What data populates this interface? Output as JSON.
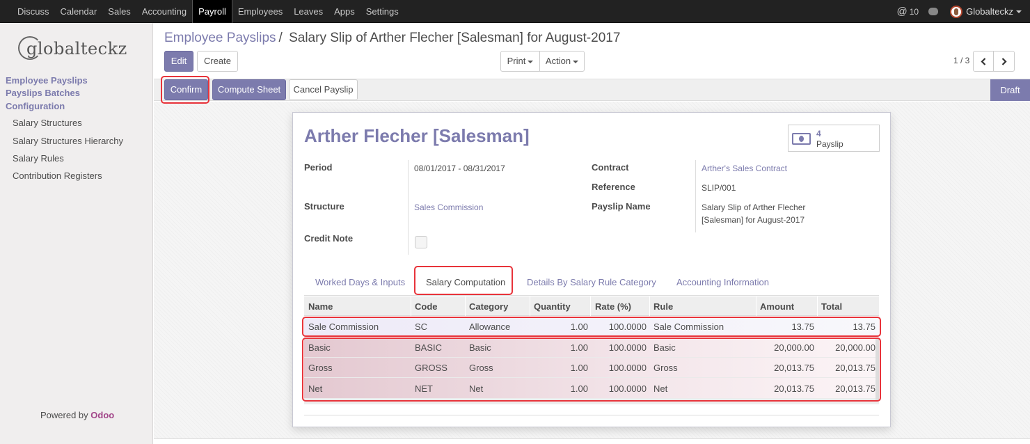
{
  "topbar": {
    "menu": [
      "Discuss",
      "Calendar",
      "Sales",
      "Accounting",
      "Payroll",
      "Employees",
      "Leaves",
      "Apps",
      "Settings"
    ],
    "active": "Payroll",
    "notification_count": "10",
    "user": "Globalteckz"
  },
  "sidebar": {
    "logo_text": "globalteckz",
    "sections": [
      "Employee Payslips",
      "Payslips Batches",
      "Configuration"
    ],
    "items": [
      "Salary Structures",
      "Salary Structures Hierarchy",
      "Salary Rules",
      "Contribution Registers"
    ],
    "powered_prefix": "Powered by",
    "powered_brand": "Odoo"
  },
  "breadcrumb": {
    "parent": "Employee Payslips",
    "separator": "/",
    "current": "Salary Slip of Arther Flecher [Salesman] for August-2017"
  },
  "buttons": {
    "edit": "Edit",
    "create": "Create",
    "print": "Print",
    "action": "Action",
    "confirm": "Confirm",
    "compute_sheet": "Compute Sheet",
    "cancel_payslip": "Cancel Payslip"
  },
  "pager": {
    "text": "1 / 3"
  },
  "status": {
    "current": "Draft"
  },
  "form": {
    "employee_name": "Arther Flecher [Salesman]",
    "stat_button": {
      "value": "4",
      "label": "Payslip"
    },
    "period_label": "Period",
    "period_value": "08/01/2017 - 08/31/2017",
    "structure_label": "Structure",
    "structure_value": "Sales Commission",
    "credit_note_label": "Credit Note",
    "contract_label": "Contract",
    "contract_value": "Arther's Sales Contract",
    "reference_label": "Reference",
    "reference_value": "SLIP/001",
    "payslip_name_label": "Payslip Name",
    "payslip_name_line1": "Salary Slip of Arther Flecher",
    "payslip_name_line2": "[Salesman] for August-2017"
  },
  "tabs": [
    "Worked Days & Inputs",
    "Salary Computation",
    "Details By Salary Rule Category",
    "Accounting Information"
  ],
  "active_tab": "Salary Computation",
  "table": {
    "columns": [
      "Name",
      "Code",
      "Category",
      "Quantity",
      "Rate (%)",
      "Rule",
      "Amount",
      "Total"
    ],
    "rows": [
      [
        "Sale Commission",
        "SC",
        "Allowance",
        "1.00",
        "100.0000",
        "Sale Commission",
        "13.75",
        "13.75"
      ],
      [
        "Basic",
        "BASIC",
        "Basic",
        "1.00",
        "100.0000",
        "Basic",
        "20,000.00",
        "20,000.00"
      ],
      [
        "Gross",
        "GROSS",
        "Gross",
        "1.00",
        "100.0000",
        "Gross",
        "20,013.75",
        "20,013.75"
      ],
      [
        "Net",
        "NET",
        "Net",
        "1.00",
        "100.0000",
        "Net",
        "20,013.75",
        "20,013.75"
      ]
    ]
  },
  "colors": {
    "accent": "#7c7bad",
    "highlight": "#e8333a",
    "topbar": "#222222"
  }
}
